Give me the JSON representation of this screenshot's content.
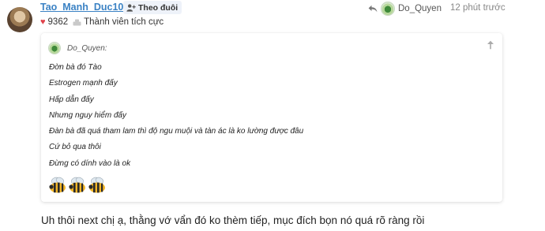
{
  "post": {
    "author": "Tao_Manh_Duc102",
    "follow_label": "Theo đuôi",
    "likes": "9362",
    "rank": "Thành viên tích cực",
    "reply_to_user": "Do_Quyen",
    "timestamp": "12 phút trước",
    "body": "Uh thôi next chị ạ, thằng vớ vẩn đó ko thèm tiếp, mục đích bọn nó quá rõ ràng rồi"
  },
  "quote": {
    "user": "Do_Quyen:",
    "lines": [
      "Đờn bà đó Tào",
      "Estrogen mạnh đấy",
      "Hấp dẫn đấy",
      "Nhưng nguy hiểm đấy",
      "Đàn bà đã quá tham lam thì độ ngu muội và tàn ác là ko lường được đâu",
      "Cứ bỏ qua thôi",
      "Đừng có dính vào là ok"
    ],
    "emoji": [
      "bee-icon",
      "bee-icon",
      "bee-icon"
    ]
  },
  "colors": {
    "link": "#3b82c4",
    "heart": "#e0424b",
    "muted": "#888888"
  }
}
